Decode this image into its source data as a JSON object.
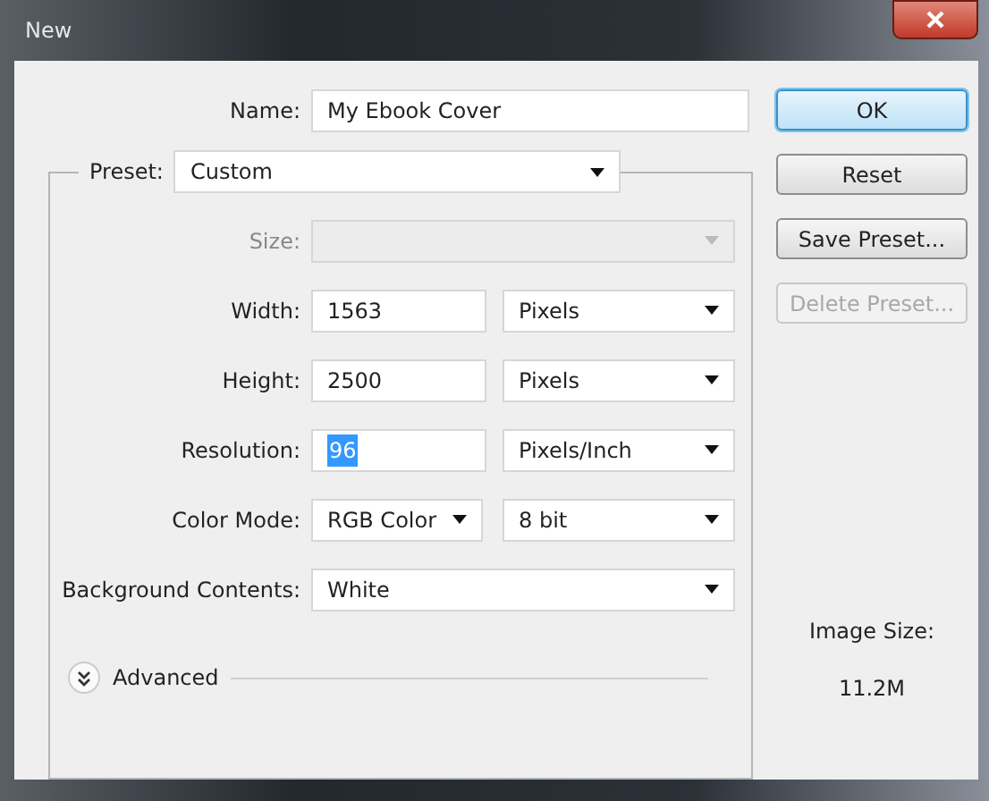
{
  "window": {
    "title": "New"
  },
  "name_field": {
    "label": "Name:",
    "value": "My Ebook Cover"
  },
  "preset": {
    "label": "Preset:",
    "value": "Custom"
  },
  "rows": [
    {
      "label": "Size:",
      "kind": "dropdown",
      "disabled": true
    },
    {
      "label": "Width:",
      "kind": "number_unit",
      "value": "1563",
      "unit": "Pixels",
      "disabled": false,
      "highlighted": false
    },
    {
      "label": "Height:",
      "kind": "number_unit",
      "value": "2500",
      "unit": "Pixels",
      "disabled": false,
      "highlighted": false
    },
    {
      "label": "Resolution:",
      "kind": "number_unit",
      "value": "96",
      "unit": "Pixels/Inch",
      "disabled": false,
      "highlighted": true
    },
    {
      "label": "Color Mode:",
      "kind": "dual_dropdown",
      "value": "RGB Color",
      "unit": "8 bit",
      "disabled": false
    },
    {
      "label": "Background Contents:",
      "kind": "dropdown",
      "value": "White",
      "disabled": false
    }
  ],
  "advanced": {
    "label": "Advanced",
    "expanded": false
  },
  "buttons": [
    {
      "label": "OK",
      "default": true,
      "disabled": false
    },
    {
      "label": "Reset",
      "default": false,
      "disabled": false
    },
    {
      "label": "Save Preset...",
      "default": false,
      "disabled": false
    },
    {
      "label": "Delete Preset...",
      "default": false,
      "disabled": true
    }
  ],
  "image_size": {
    "label": "Image Size:",
    "value": "11.2M"
  }
}
